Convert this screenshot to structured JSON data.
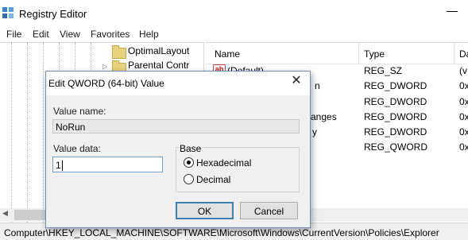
{
  "window": {
    "title": "Registry Editor"
  },
  "menu": {
    "file": "File",
    "edit": "Edit",
    "view": "View",
    "favorites": "Favorites",
    "help": "Help"
  },
  "tree": {
    "items": [
      {
        "label": "OptimalLayout"
      },
      {
        "label": "Parental Contr"
      }
    ]
  },
  "list": {
    "columns": {
      "name": "Name",
      "type": "Type",
      "data": "Da"
    },
    "rows": [
      {
        "name": "(Default)",
        "name_suffix": "",
        "type": "REG_SZ",
        "data": "(v"
      },
      {
        "name": "",
        "name_suffix": "n",
        "type": "REG_DWORD",
        "data": "0x"
      },
      {
        "name": "",
        "name_suffix": "",
        "type": "REG_DWORD",
        "data": "0x"
      },
      {
        "name": "",
        "name_suffix": "anges",
        "type": "REG_DWORD",
        "data": "0x"
      },
      {
        "name": "",
        "name_suffix": "y",
        "type": "REG_DWORD",
        "data": "0x"
      },
      {
        "name": "",
        "name_suffix": "",
        "type": "REG_QWORD",
        "data": "0x"
      }
    ]
  },
  "status": {
    "path": "Computer\\HKEY_LOCAL_MACHINE\\SOFTWARE\\Microsoft\\Windows\\CurrentVersion\\Policies\\Explorer"
  },
  "dialog": {
    "title": "Edit QWORD (64-bit) Value",
    "value_name_label": "Value name:",
    "value_name": "NoRun",
    "value_data_label": "Value data:",
    "value_data": "1",
    "base_label": "Base",
    "radio_hex": "Hexadecimal",
    "radio_dec": "Decimal",
    "selected_base": "Hexadecimal",
    "ok": "OK",
    "cancel": "Cancel",
    "close_glyph": "✕"
  }
}
